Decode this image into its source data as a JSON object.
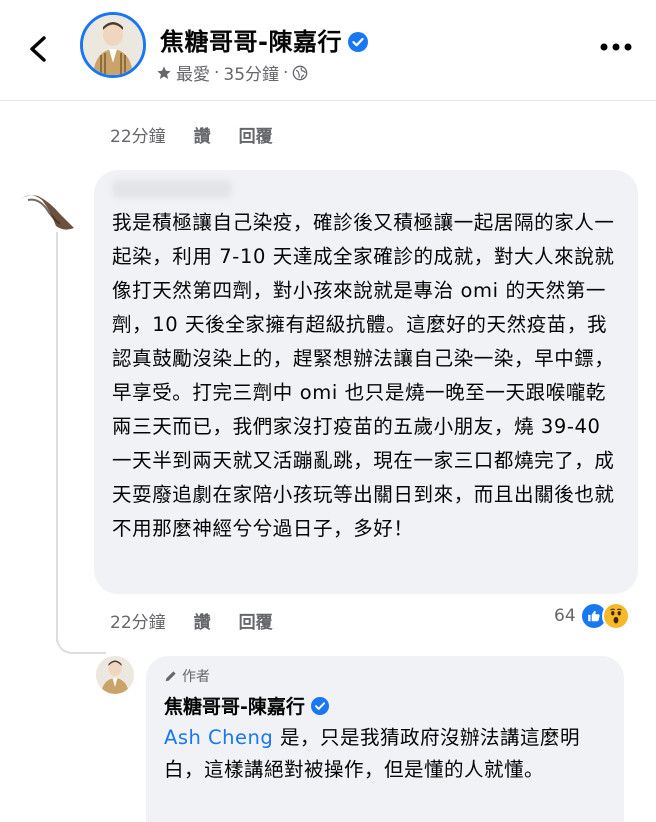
{
  "header": {
    "page_name": "焦糖哥哥-陳嘉行",
    "favorite_label": "最愛",
    "separator": "·",
    "time": "35分鐘",
    "separator2": "·"
  },
  "prev_comment_actions": {
    "time": "22分鐘",
    "like": "讚",
    "reply": "回覆"
  },
  "comment": {
    "text": "我是積極讓自己染疫，確診後又積極讓一起居隔的家人一起染，利用 7-10 天達成全家確診的成就，對大人來說就像打天然第四劑，對小孩來說就是專治 omi 的天然第一劑，10 天後全家擁有超級抗體。這麼好的天然疫苗，我認真鼓勵沒染上的，趕緊想辦法讓自己染一染，早中鏢，早享受。打完三劑中 omi 也只是燒一晚至一天跟喉嚨乾兩三天而已，我們家沒打疫苗的五歲小朋友，燒 39-40 一天半到兩天就又活蹦亂跳，現在一家三口都燒完了，成天耍廢追劇在家陪小孩玩等出關日到來，而且出關後也就不用那麼神經兮兮過日子，多好！",
    "actions": {
      "time": "22分鐘",
      "like": "讚",
      "reply": "回覆"
    },
    "reaction_count": "64"
  },
  "reply": {
    "author_badge": "作者",
    "name": "焦糖哥哥-陳嘉行",
    "mention": "Ash Cheng",
    "text": " 是，只是我猜政府沒辦法講這麼明白，這樣講絕對被操作，但是懂的人就懂。"
  },
  "colors": {
    "accent": "#1877f2",
    "muted": "#65676b",
    "bubble": "#f0f2f5"
  },
  "icons": [
    "back-arrow-icon",
    "verified-badge-icon",
    "star-icon",
    "globe-icon",
    "more-options-icon",
    "like-reaction-icon",
    "wow-reaction-icon",
    "pen-icon"
  ]
}
